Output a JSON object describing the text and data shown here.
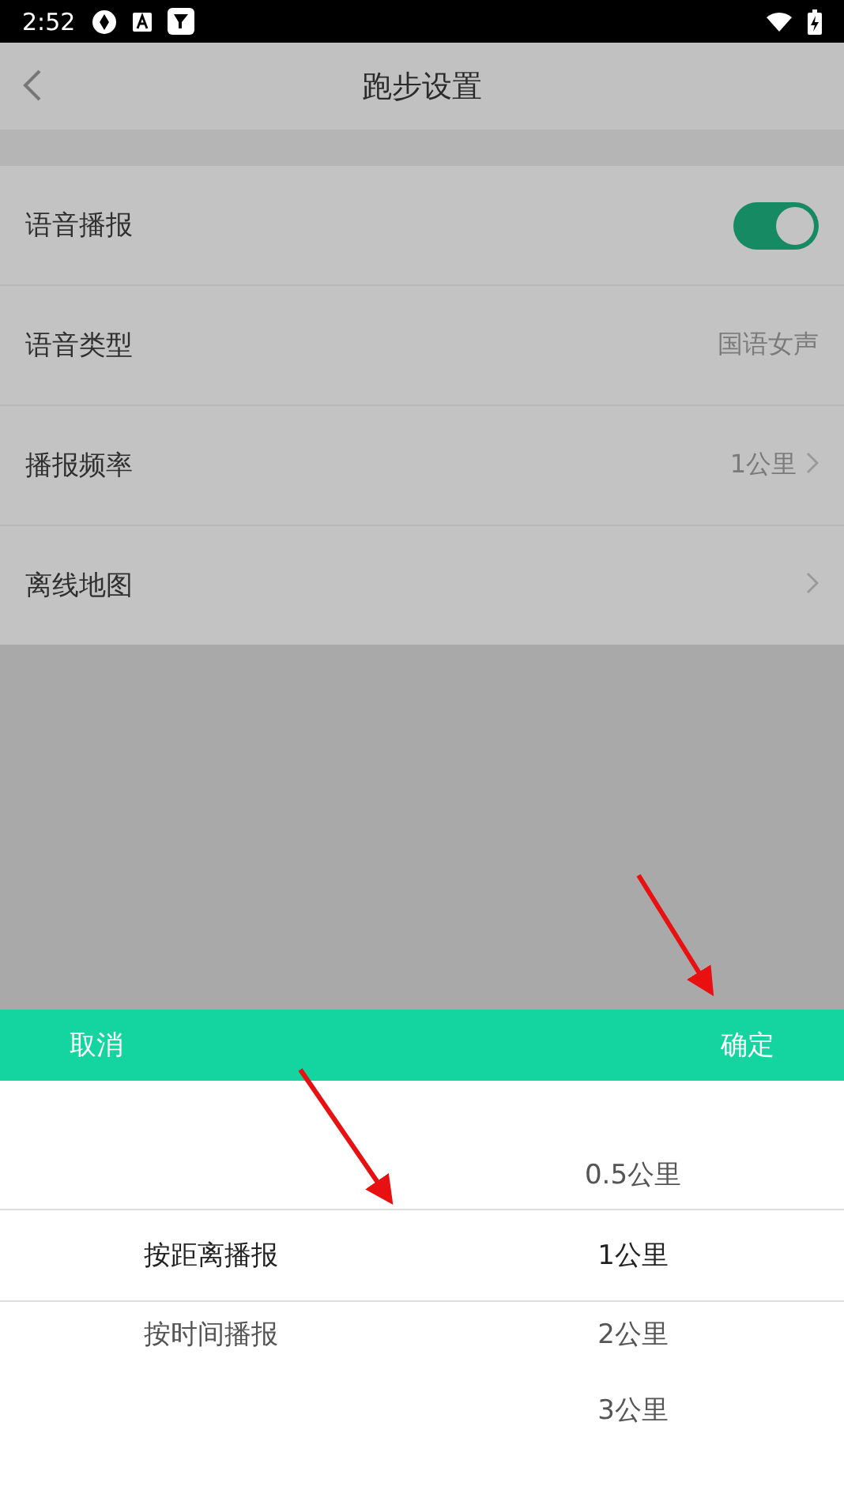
{
  "status_bar": {
    "time": "2:52"
  },
  "header": {
    "title": "跑步设置"
  },
  "settings": [
    {
      "kind": "toggle",
      "label": "语音播报",
      "on": true
    },
    {
      "kind": "value",
      "label": "语音类型",
      "value": "国语女声",
      "chevron": false
    },
    {
      "kind": "value",
      "label": "播报频率",
      "value": "1公里",
      "chevron": true
    },
    {
      "kind": "value",
      "label": "离线地图",
      "chevron": true
    }
  ],
  "picker": {
    "cancel": "取消",
    "confirm": "确定",
    "mode_options": [
      {
        "label": "按距离播报",
        "selected": true
      },
      {
        "label": "按时间播报",
        "selected": false
      }
    ],
    "interval_options": [
      {
        "label": "0.5公里",
        "selected": false
      },
      {
        "label": "1公里",
        "selected": true
      },
      {
        "label": "2公里",
        "selected": false
      },
      {
        "label": "3公里",
        "selected": false
      }
    ]
  }
}
